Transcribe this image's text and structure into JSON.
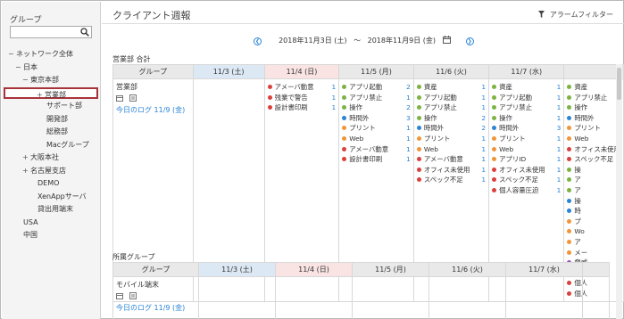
{
  "colors": {
    "accent": "#2a84d6",
    "selected_border": "#a8343a",
    "sat_header": "#dde8f5",
    "sun_header": "#f9e3e3"
  },
  "sidebar": {
    "title": "グループ",
    "search": {
      "value": "",
      "placeholder": ""
    },
    "tree": [
      {
        "toggle": "−",
        "label": "ネットワーク全体"
      },
      {
        "toggle": "−",
        "label": "日本"
      },
      {
        "toggle": "−",
        "label": "東京本部"
      },
      {
        "toggle": "+",
        "label": "営業部",
        "selected": true
      },
      {
        "toggle": "",
        "label": "サポート部"
      },
      {
        "toggle": "",
        "label": "開発部"
      },
      {
        "toggle": "",
        "label": "総務部"
      },
      {
        "toggle": "",
        "label": "Macグループ"
      },
      {
        "toggle": "+",
        "label": "大阪本社"
      },
      {
        "toggle": "+",
        "label": "名古屋支店"
      },
      {
        "toggle": "",
        "label": "DEMO"
      },
      {
        "toggle": "",
        "label": "XenAppサーバ"
      },
      {
        "toggle": "",
        "label": "貸出用端末"
      },
      {
        "toggle": "",
        "label": "USA"
      },
      {
        "toggle": "",
        "label": "中国"
      }
    ]
  },
  "main": {
    "title": "クライアント週報",
    "filter_label": "アラームフィルター",
    "date_from": "2018年11月3日 (土)",
    "date_sep": "～",
    "date_to": "2018年11月9日 (金)",
    "section1_label": "営業部 合計",
    "section2_label": "所属グループ",
    "group_header": "グループ",
    "days": [
      "11/3 (土)",
      "11/4 (日)",
      "11/5 (月)",
      "11/6 (火)",
      "11/7 (水)"
    ],
    "table1": {
      "group_name": "営業部",
      "log_link": "今日のログ 11/9 (金)",
      "columns": [
        [],
        [
          {
            "c": "red",
            "t": "アメーバ動意",
            "n": "1"
          },
          {
            "c": "red",
            "t": "残業で警告",
            "n": "1"
          },
          {
            "c": "red",
            "t": "設計書印刷",
            "n": "1"
          }
        ],
        [
          {
            "c": "green",
            "t": "アプリ起動",
            "n": "2"
          },
          {
            "c": "green",
            "t": "アプリ禁止",
            "n": "1"
          },
          {
            "c": "green",
            "t": "操作",
            "n": "2"
          },
          {
            "c": "blue",
            "t": "時間外",
            "n": "3"
          },
          {
            "c": "orange",
            "t": "プリント",
            "n": "1"
          },
          {
            "c": "orange",
            "t": "Web",
            "n": "1"
          },
          {
            "c": "red",
            "t": "アメーバ動意",
            "n": "1"
          },
          {
            "c": "red",
            "t": "設計書印刷",
            "n": "1"
          }
        ],
        [
          {
            "c": "green",
            "t": "資産",
            "n": "1"
          },
          {
            "c": "green",
            "t": "アプリ起動",
            "n": "1"
          },
          {
            "c": "green",
            "t": "アプリ禁止",
            "n": "1"
          },
          {
            "c": "green",
            "t": "操作",
            "n": "2"
          },
          {
            "c": "blue",
            "t": "時間外",
            "n": "2"
          },
          {
            "c": "orange",
            "t": "プリント",
            "n": "1"
          },
          {
            "c": "orange",
            "t": "Web",
            "n": "1"
          },
          {
            "c": "red",
            "t": "アメーバ動意",
            "n": "1"
          },
          {
            "c": "red",
            "t": "オフィス未使用",
            "n": "1"
          },
          {
            "c": "red",
            "t": "スペック不足",
            "n": "1"
          }
        ],
        [
          {
            "c": "green",
            "t": "資産",
            "n": "1"
          },
          {
            "c": "green",
            "t": "アプリ起動",
            "n": "1"
          },
          {
            "c": "green",
            "t": "アプリ禁止",
            "n": "1"
          },
          {
            "c": "green",
            "t": "操作",
            "n": "1"
          },
          {
            "c": "blue",
            "t": "時間外",
            "n": "3"
          },
          {
            "c": "orange",
            "t": "プリント",
            "n": "1"
          },
          {
            "c": "orange",
            "t": "Web",
            "n": "1"
          },
          {
            "c": "orange",
            "t": "アプリID",
            "n": "1"
          },
          {
            "c": "red",
            "t": "オフィス未使用",
            "n": "1"
          },
          {
            "c": "red",
            "t": "スペック不足",
            "n": "1"
          },
          {
            "c": "red",
            "t": "個人容量圧迫",
            "n": "1"
          }
        ],
        [
          {
            "c": "green",
            "t": "資産",
            "n": "1"
          },
          {
            "c": "green",
            "t": "アプリ禁止",
            "n": "1"
          },
          {
            "c": "green",
            "t": "操作",
            "n": "1"
          },
          {
            "c": "blue",
            "t": "時間外",
            "n": "1"
          },
          {
            "c": "orange",
            "t": "プリント",
            "n": "1"
          },
          {
            "c": "orange",
            "t": "Web",
            "n": "1"
          },
          {
            "c": "red",
            "t": "オフィス未使用",
            "n": "1"
          },
          {
            "c": "red",
            "t": "スペック不足",
            "n": "1"
          }
        ]
      ],
      "partial_column": [
        {
          "c": "green",
          "t": "操"
        },
        {
          "c": "green",
          "t": "ア"
        },
        {
          "c": "green",
          "t": "ア"
        },
        {
          "c": "blue",
          "t": "操"
        },
        {
          "c": "blue",
          "t": "時"
        },
        {
          "c": "orange",
          "t": "プ"
        },
        {
          "c": "orange",
          "t": "Wo"
        },
        {
          "c": "orange",
          "t": "ア"
        },
        {
          "c": "orange",
          "t": "メー"
        },
        {
          "c": "purple",
          "t": "脅威"
        },
        {
          "c": "red",
          "t": "ア"
        },
        {
          "c": "red",
          "t": "個人"
        },
        {
          "c": "red",
          "t": "個人"
        }
      ]
    },
    "table2": {
      "group_name": "モバイル端末",
      "log_link": "今日のログ 11/9 (金)"
    }
  }
}
